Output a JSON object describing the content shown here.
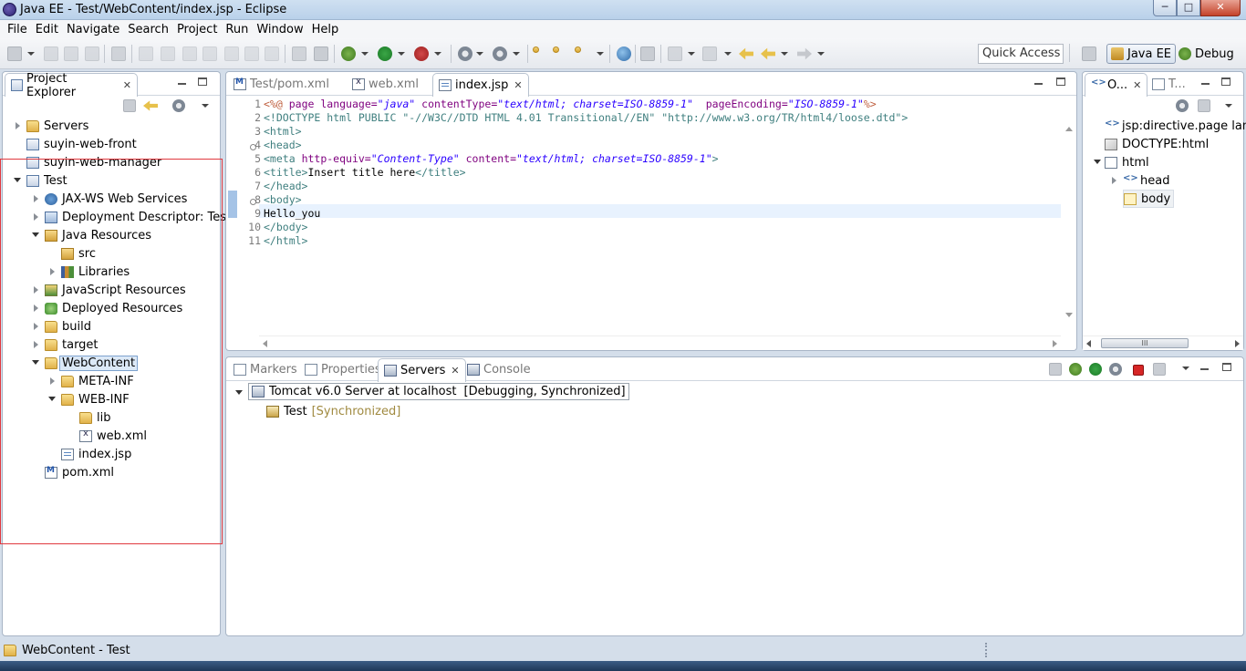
{
  "window": {
    "title": "Java EE - Test/WebContent/index.jsp - Eclipse",
    "min_label": "─",
    "max_label": "□",
    "close_label": "✕"
  },
  "menu": [
    "File",
    "Edit",
    "Navigate",
    "Search",
    "Project",
    "Run",
    "Window",
    "Help"
  ],
  "quick_access": "Quick Access",
  "perspectives": [
    {
      "label": "Java EE",
      "active": true
    },
    {
      "label": "Debug",
      "active": false
    }
  ],
  "project_explorer": {
    "title": "Project Explorer",
    "items": [
      {
        "label": "Servers",
        "icon": "folder-icon"
      },
      {
        "label": "suyin-web-front",
        "icon": "project-icon"
      },
      {
        "label": "suyin-web-manager",
        "icon": "project-icon"
      },
      {
        "label": "Test",
        "icon": "web-project-icon"
      },
      {
        "label": "JAX-WS Web Services",
        "icon": "webservice-icon"
      },
      {
        "label": "Deployment Descriptor: Test",
        "icon": "descriptor-icon"
      },
      {
        "label": "Java Resources",
        "icon": "java-resources-icon"
      },
      {
        "label": "src",
        "icon": "package-folder-icon"
      },
      {
        "label": "Libraries",
        "icon": "library-icon"
      },
      {
        "label": "JavaScript Resources",
        "icon": "js-resources-icon"
      },
      {
        "label": "Deployed Resources",
        "icon": "deployed-icon"
      },
      {
        "label": "build",
        "icon": "folder-icon"
      },
      {
        "label": "target",
        "icon": "folder-icon"
      },
      {
        "label": "WebContent",
        "icon": "folder-icon"
      },
      {
        "label": "META-INF",
        "icon": "folder-icon"
      },
      {
        "label": "WEB-INF",
        "icon": "folder-icon"
      },
      {
        "label": "lib",
        "icon": "folder-icon"
      },
      {
        "label": "web.xml",
        "icon": "xml-file-icon"
      },
      {
        "label": "index.jsp",
        "icon": "jsp-file-icon"
      },
      {
        "label": "pom.xml",
        "icon": "pom-file-icon"
      }
    ]
  },
  "editor": {
    "tabs": [
      {
        "label": "Test/pom.xml"
      },
      {
        "label": "web.xml"
      },
      {
        "label": "index.jsp",
        "close": "✕"
      }
    ],
    "line_numbers": [
      "1",
      "2",
      "3",
      "4",
      "5",
      "6",
      "7",
      "8",
      "9",
      "10",
      "11"
    ],
    "line1": {
      "open": "<%@",
      "page": "page",
      "lang_attr": "language=",
      "lang_val": "\"java\"",
      "ct_attr": "contentType=",
      "ct_val": "\"text/html; charset=ISO-8859-1\"",
      "pe_attr": "pageEncoding=",
      "pe_val": "\"ISO-8859-1\"",
      "close": "%>"
    },
    "line2": {
      "doctype": "<!DOCTYPE html PUBLIC ",
      "pub": "\"-//W3C//DTD HTML 4.01 Transitional//EN\"",
      "sys": "\"http://www.w3.org/TR/html4/loose.dtd\"",
      "end": ">"
    },
    "line3": "<html>",
    "line4": "<head>",
    "line5": {
      "open": "<meta",
      "attr1": "http-equiv=",
      "val1": "\"Content-Type\"",
      "attr2": "content=",
      "val2": "\"text/html; charset=ISO-8859-1\"",
      "close": ">"
    },
    "line6": {
      "open": "<title>",
      "text": "Insert title here",
      "close": "</title>"
    },
    "line7": "</head>",
    "line8": "<body>",
    "line9": "Hello_you",
    "line10": "</body>",
    "line11": "</html>"
  },
  "outline": {
    "tabs": [
      {
        "label": "O...",
        "close": "✕"
      },
      {
        "label": "T..."
      }
    ],
    "items": [
      {
        "label": "jsp:directive.page lang"
      },
      {
        "label": "DOCTYPE:html"
      },
      {
        "label": "html"
      },
      {
        "label": "head"
      },
      {
        "label": "body"
      }
    ],
    "hscroll_grip": "III"
  },
  "bottom": {
    "tabs": [
      {
        "label": "Markers"
      },
      {
        "label": "Properties"
      },
      {
        "label": "Servers",
        "close": "✕"
      },
      {
        "label": "Console"
      }
    ],
    "server": {
      "name": "Tomcat v6.0 Server at localhost",
      "state": "[Debugging, Synchronized]"
    },
    "module": {
      "name": "Test",
      "state": "[Synchronized]"
    }
  },
  "status": {
    "text": "WebContent - Test"
  },
  "colors": {
    "selection_outline": "#e0393f",
    "accent": "#2a00ff"
  }
}
